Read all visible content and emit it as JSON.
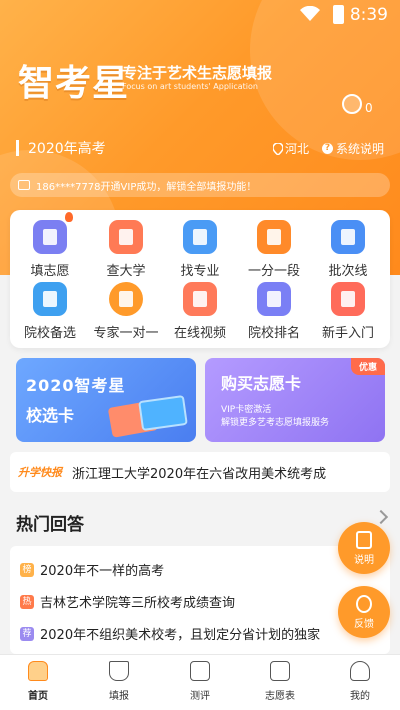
{
  "status": {
    "time": "8:39"
  },
  "brand": {
    "logo": "智考星",
    "slogan": "专注于艺术生志愿填报",
    "slogan_en": "Focus on art students' Application"
  },
  "header": {
    "bell_count": "0",
    "year": "2020年高考",
    "location": "河北",
    "help": "系统说明"
  },
  "notice": {
    "text": "186****7778开通VIP成功，解锁全部填报功能！"
  },
  "grid": [
    {
      "label": "填志愿",
      "color": "#7b7ff2"
    },
    {
      "label": "查大学",
      "color": "#ff7a55"
    },
    {
      "label": "找专业",
      "color": "#4a9bf5"
    },
    {
      "label": "一分一段",
      "color": "#ff8a2a"
    },
    {
      "label": "批次线",
      "color": "#4a8ff5"
    },
    {
      "label": "院校备选",
      "color": "#3ea0f0"
    },
    {
      "label": "专家一对一",
      "color": "#ff9a2a"
    },
    {
      "label": "在线视频",
      "color": "#ff7a5a"
    },
    {
      "label": "院校排名",
      "color": "#7a7ff5"
    },
    {
      "label": "新手入门",
      "color": "#ff6b5a"
    }
  ],
  "banners": {
    "left": {
      "line1": "2020智考星",
      "line2": "校选卡"
    },
    "right": {
      "title": "购买志愿卡",
      "tag": "优惠",
      "line1": "VIP卡密激活",
      "line2": "解锁更多艺考志愿填报服务"
    }
  },
  "news": {
    "brand": "升学快报",
    "headline": "浙江理工大学2020年在六省改用美术统考成"
  },
  "hot": {
    "title": "热门回答",
    "items": [
      {
        "badge": "榜",
        "badge_color": "#ffb24a",
        "text": "2020年不一样的高考"
      },
      {
        "badge": "热",
        "badge_color": "#ff7a4a",
        "text": "吉林艺术学院等三所校考成绩查询"
      },
      {
        "badge": "荐",
        "badge_color": "#9b8bf0",
        "text": "2020年不组织美术校考，且划定分省计划的独家"
      }
    ]
  },
  "fabs": {
    "explain": "说明",
    "feedback": "反馈"
  },
  "tabs": [
    {
      "label": "首页",
      "active": true
    },
    {
      "label": "填报"
    },
    {
      "label": "测评"
    },
    {
      "label": "志愿表"
    },
    {
      "label": "我的"
    }
  ]
}
